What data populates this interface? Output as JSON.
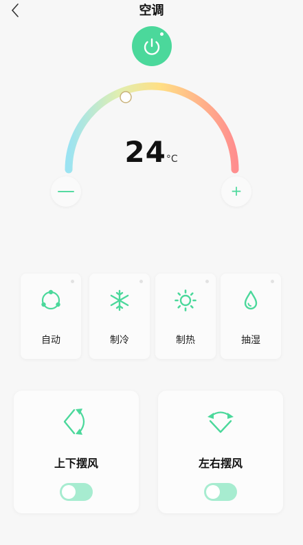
{
  "header": {
    "title": "空调",
    "back_icon": "chevron-left-icon"
  },
  "power": {
    "icon": "power-icon",
    "color": "#4bd89b"
  },
  "temperature": {
    "value": "24",
    "unit": "°C",
    "minus_label": "—",
    "plus_label": "+"
  },
  "modes": [
    {
      "label": "自动",
      "icon": "auto-cycle-icon"
    },
    {
      "label": "制冷",
      "icon": "snowflake-icon"
    },
    {
      "label": "制热",
      "icon": "sun-icon"
    },
    {
      "label": "抽湿",
      "icon": "water-drop-icon"
    }
  ],
  "swing": [
    {
      "label": "上下摆风",
      "icon": "vertical-swing-icon",
      "enabled": false
    },
    {
      "label": "左右摆风",
      "icon": "horizontal-swing-icon",
      "enabled": false
    }
  ],
  "colors": {
    "accent": "#4bd89b",
    "gauge_cold": "#9be3f2",
    "gauge_mid": "#ffdf85",
    "gauge_hot": "#ff8e8e",
    "toggle_track": "#a7ecd0"
  }
}
